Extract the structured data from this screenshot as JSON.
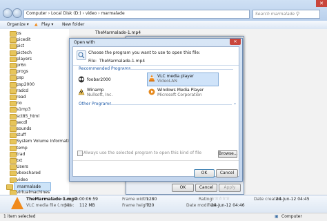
{
  "explorer": {
    "address": "Computer  ›  Local Disk (D:)  ›  video  ›  marmalade",
    "search_placeholder": "Search marmalade",
    "toolbar": {
      "organize": "Organize ▾",
      "play": "Play ▾",
      "new_folder": "New folder"
    },
    "sidebar": [
      "os",
      "picedit",
      "pict",
      "pictech",
      "players",
      "pr6n",
      "progs",
      "psp",
      "psp2000",
      "radcd",
      "read",
      "rio",
      "s1mp3",
      "sct85_html",
      "secdl",
      "sounds",
      "stuff",
      "System Volume Information",
      "temp",
      "trad",
      "txt",
      "Users",
      "vboxshared",
      "video",
      "marmalade",
      "virtualmachines"
    ],
    "selected_folder": "marmalade",
    "file_title": "TheMarmalade-1.mp4",
    "details": {
      "name": "TheMarmalade-1.mp4",
      "type": "VLC media file (.mp4)",
      "length_label": "Length:",
      "length": "00:06:59",
      "size_label": "Size:",
      "size": "112 MB",
      "fw_label": "Frame width:",
      "fw": "1280",
      "fh_label": "Frame height:",
      "fh": "720",
      "rating_label": "Rating:",
      "rating": "☆☆☆☆☆",
      "modified_label": "Date modified:",
      "modified": "24-Jun-12 04:46",
      "created_label": "Date created:",
      "created": "24-Jun-12 04:45"
    },
    "status_left": "1 item selected",
    "status_right": "Computer"
  },
  "bg_dialog": {
    "ok": "OK",
    "cancel": "Cancel",
    "apply": "Apply"
  },
  "open_with": {
    "title": "Open with",
    "prompt": "Choose the program you want to use to open this file:",
    "file_label": "File:",
    "file_name": "TheMarmalade-1.mp4",
    "recommended_title": "Recommended Programs",
    "programs": [
      {
        "name": "VLC media player",
        "vendor": "VideoLAN",
        "icon": "vlc-cone-icon",
        "selected": true
      },
      {
        "name": "foobar2000",
        "vendor": "",
        "icon": "foobar-alien-icon",
        "selected": false
      },
      {
        "name": "Winamp",
        "vendor": "Nullsoft, Inc.",
        "icon": "winamp-icon",
        "selected": false
      },
      {
        "name": "Windows Media Player",
        "vendor": "Microsoft Corporation",
        "icon": "wmp-icon",
        "selected": false
      }
    ],
    "other_title": "Other Programs",
    "always_use": "Always use the selected program to open this kind of file",
    "browse": "Browse...",
    "ok": "OK",
    "cancel": "Cancel"
  },
  "colors": {
    "accent": "#1e5aa8",
    "vlc_orange": "#f08a1c",
    "selection": "#cde4f8"
  }
}
